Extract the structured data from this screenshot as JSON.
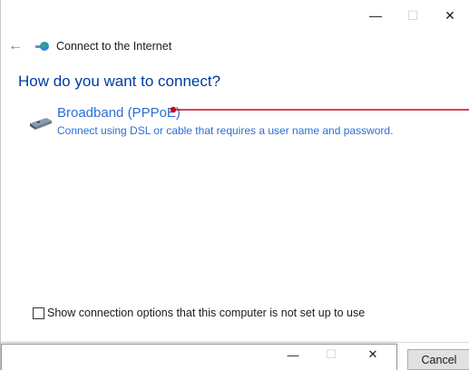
{
  "window": {
    "minimize_glyph": "—",
    "maximize_glyph": "☐",
    "close_glyph": "✕"
  },
  "nav": {
    "back_glyph": "←",
    "title": "Connect to the Internet"
  },
  "heading": "How do you want to connect?",
  "option": {
    "title": "Broadband (PPPoE)",
    "description": "Connect using DSL or cable that requires a user name and password.",
    "icon": "network-adapter-icon",
    "annotation_color": "#d0021b"
  },
  "checkbox": {
    "label": "Show connection options that this computer is not set up to use",
    "checked": false
  },
  "footer": {
    "cancel_label": "Cancel"
  },
  "popup": {
    "minimize_glyph": "—",
    "maximize_glyph": "☐",
    "close_glyph": "✕"
  },
  "colors": {
    "heading": "#003c9e",
    "link": "#2a6fd6",
    "annotation": "#d0021b"
  }
}
